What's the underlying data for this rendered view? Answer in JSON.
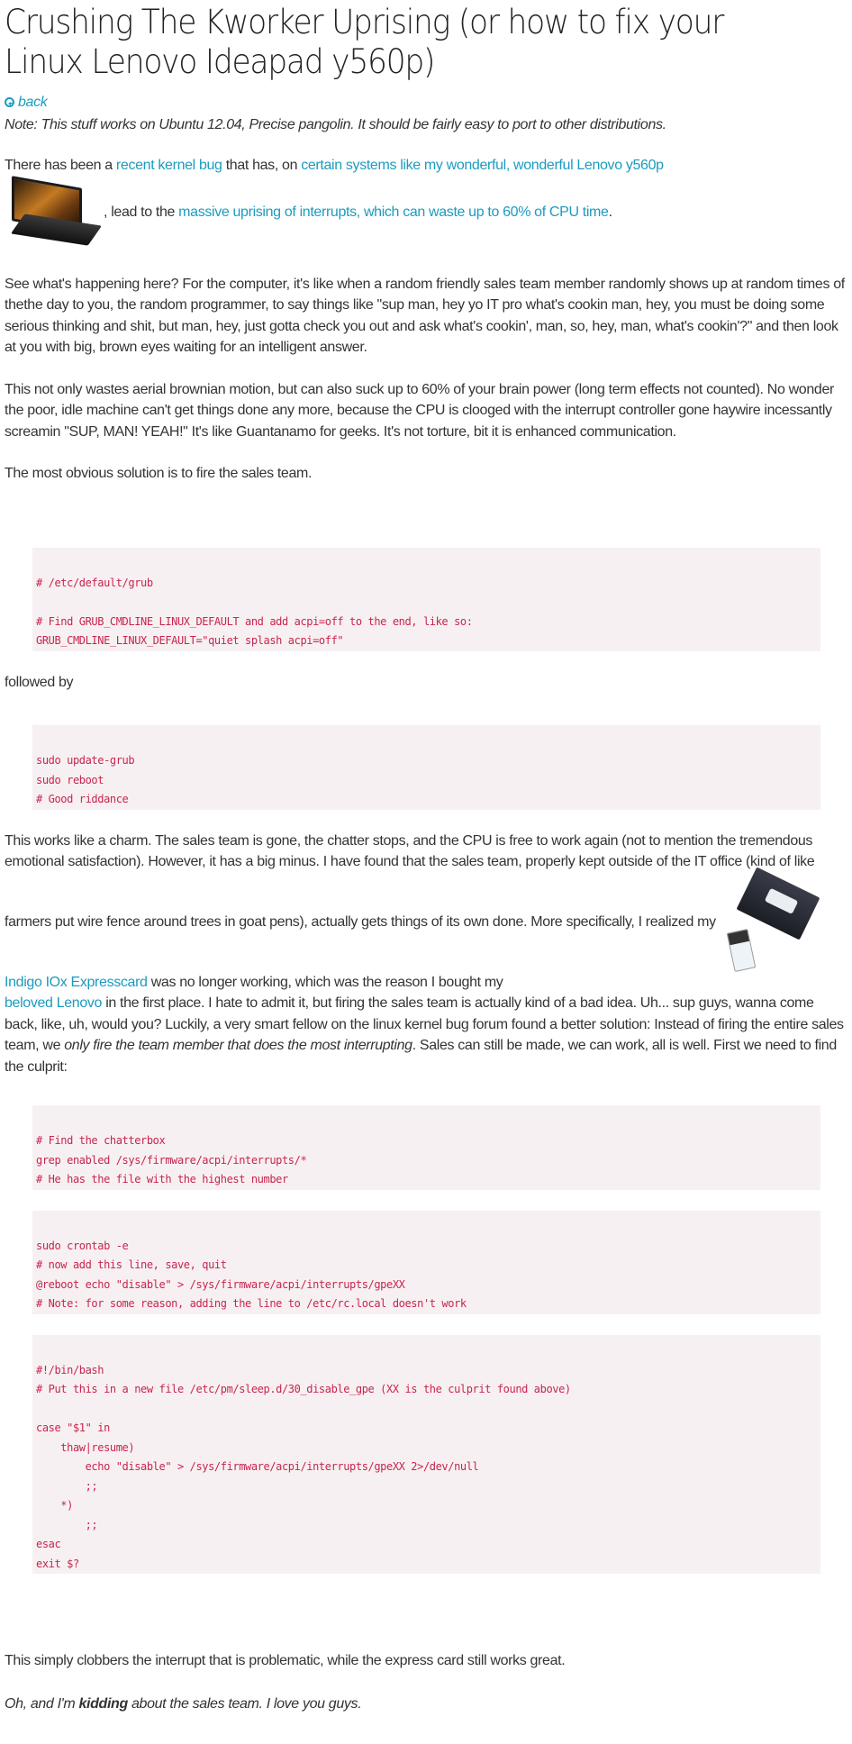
{
  "title": "Crushing The Kworker Uprising (or how to fix your Linux Lenovo Ideapad y560p)",
  "back_link": {
    "icon": "arrow-circle-left-icon",
    "label": "back"
  },
  "note": "Note: This stuff works on Ubuntu 12.04, Precise pangolin. It should be fairly easy to port to other distributions.",
  "intro": {
    "text1": "There has been a ",
    "link1": "recent kernel bug",
    "text2": " that has, on ",
    "link2": "certain systems like my wonderful, wonderful Lenovo y560p",
    "image_alt": "Lenovo Ideapad y560p laptop",
    "text3": ", lead to the ",
    "link3": "massive uprising of interrupts, which can waste up to 60% of CPU time",
    "text4": "."
  },
  "para_sales": "See what's happening here? For the computer, it's like when a random friendly sales team member randomly shows up at random times of thethe day to you, the random programmer, to say things like \"sup man, hey yo IT pro what's cookin man, hey, you must be doing some serious thinking and shit, but man, hey, just gotta check you out and ask what's cookin', man, so, hey, man, what's cookin'?\" and then look at you with big, brown eyes waiting for an intelligent answer.",
  "para_waste": "This not only wastes aerial brownian motion, but can also suck up to 60% of your brain power (long term effects not counted). No wonder the poor, idle machine can't get things done any more, because the CPU is clooged with the interrupt controller gone haywire incessantly screamin \"SUP, MAN! YEAH!\" It's like Guantanamo for geeks. It's not torture, bit it is enhanced communication.",
  "para_solution": "The most obvious solution is to fire the sales team.",
  "code_grub": [
    "# /etc/default/grub",
    "",
    "# Find GRUB_CMDLINE_LINUX_DEFAULT and add acpi=off to the end, like so:",
    "GRUB_CMDLINE_LINUX_DEFAULT=\"quiet splash acpi=off\""
  ],
  "followed_by": "followed by",
  "code_update": [
    "sudo update-grub",
    "sudo reboot",
    "# Good riddance"
  ],
  "para_charm": {
    "text1": "This works like a charm. The sales team is gone, the chatter stops, and the CPU is free to work again (not to mention the tremendous emotional satisfaction). However, it has a big minus. I have found that the sales team, properly kept outside of the IT office (kind of like farmers put wire fence around trees in goat pens), actually gets things of its own done. More specifically, I realized my ",
    "image_alt": "Indigo IOx Expresscard box",
    "link1": "Indigo IOx Expresscard",
    "text2": "  was no longer working, which was the reason I bought my ",
    "link2": "beloved Lenovo",
    "text3": " in the first place. I hate to admit it, but firing the sales team is actually kind of a bad idea. Uh... sup guys, wanna come back, like, uh, would you? Luckily, a very smart fellow on the linux kernel bug forum found a better solution: Instead of firing the entire sales team, we ",
    "emphasis": "only fire the team member that does the most interrupting",
    "text4": ". Sales can still be made, we can work, all is well. First we need to find the culprit:"
  },
  "code_find": [
    "# Find the chatterbox",
    "grep enabled /sys/firmware/acpi/interrupts/*",
    "# He has the file with the highest number"
  ],
  "code_crontab": [
    "sudo crontab -e",
    "# now add this line, save, quit",
    "@reboot echo \"disable\" > /sys/firmware/acpi/interrupts/gpeXX",
    "# Note: for some reason, adding the line to /etc/rc.local doesn't work"
  ],
  "code_script": [
    "#!/bin/bash",
    "# Put this in a new file /etc/pm/sleep.d/30_disable_gpe (XX is the culprit found above)",
    "",
    "case \"$1\" in",
    "    thaw|resume)",
    "        echo \"disable\" > /sys/firmware/acpi/interrupts/gpeXX 2>/dev/null",
    "        ;;",
    "    *)",
    "        ;;",
    "esac",
    "exit $?"
  ],
  "para_clobber": "This simply clobbers the interrupt that is problematic, while the express card still works great.",
  "closing": {
    "text1": "Oh, and I'm ",
    "bold": "kidding",
    "text2": " about the sales team. I love you guys."
  },
  "colors": {
    "link": "#1b9bbf",
    "code_text": "#c7254e",
    "code_bg": "#f7f0f2",
    "body_text": "#333333"
  }
}
